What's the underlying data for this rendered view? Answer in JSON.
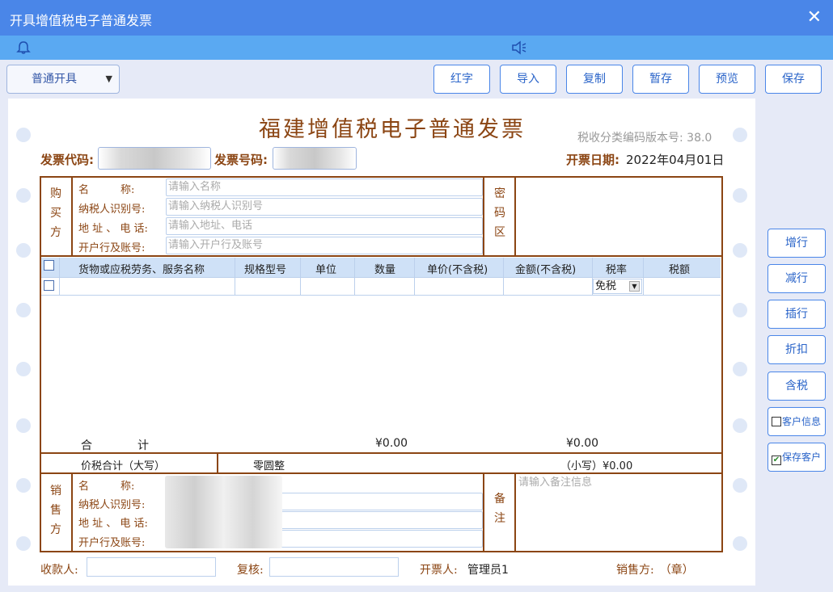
{
  "window": {
    "title": "开具增值税电子普通发票",
    "close": "✕"
  },
  "toolbar": {
    "mode_select": "普通开具",
    "buttons": [
      "红字",
      "导入",
      "复制",
      "暂存",
      "预览",
      "保存"
    ]
  },
  "side_buttons": [
    "增行",
    "减行",
    "插行",
    "折扣",
    "含税"
  ],
  "side_checks": [
    {
      "label": "客户信息",
      "checked": false
    },
    {
      "label": "保存客户",
      "checked": true
    }
  ],
  "invoice": {
    "title": "福建增值税电子普通发票",
    "version": "税收分类编码版本号: 38.0",
    "code_label": "发票代码:",
    "number_label": "发票号码:",
    "date_label": "开票日期:",
    "date": "2022年04月01日"
  },
  "buyer": {
    "section": "购买方",
    "rows": [
      {
        "label": "名　　　称:",
        "placeholder": "请输入名称"
      },
      {
        "label": "纳税人识别号:",
        "placeholder": "请输入纳税人识别号"
      },
      {
        "label": "地 址 、 电 话:",
        "placeholder": "请输入地址、电话"
      },
      {
        "label": "开户行及账号:",
        "placeholder": "请输入开户行及账号"
      }
    ],
    "password_area": "密码区"
  },
  "items_table": {
    "headers": [
      "货物或应税劳务、服务名称",
      "规格型号",
      "单位",
      "数量",
      "单价(不含税)",
      "金额(不含税)",
      "税率",
      "税额"
    ],
    "tax_rate_value": "免税",
    "total_label": "合　　　　计",
    "total_amount": "¥0.00",
    "total_tax": "¥0.00"
  },
  "total_capital": {
    "label": "价税合计（大写）",
    "value": "零圆整",
    "small_label": "（小写）¥0.00"
  },
  "seller": {
    "section": "销售方",
    "rows": [
      {
        "label": "名　　　称:"
      },
      {
        "label": "纳税人识别号:"
      },
      {
        "label": "地 址 、 电 话:"
      },
      {
        "label": "开户行及账号:"
      }
    ],
    "remark_label": "备注",
    "remark_placeholder": "请输入备注信息"
  },
  "footer": {
    "payee_label": "收款人:",
    "reviewer_label": "复核:",
    "drawer_label": "开票人:",
    "drawer_value": "管理员1",
    "seller_seal": "销售方:　（章）"
  },
  "colors": {
    "accent": "#4a86e8",
    "invoice_brown": "#8b4513",
    "notice_bar": "#5aa9f2"
  }
}
